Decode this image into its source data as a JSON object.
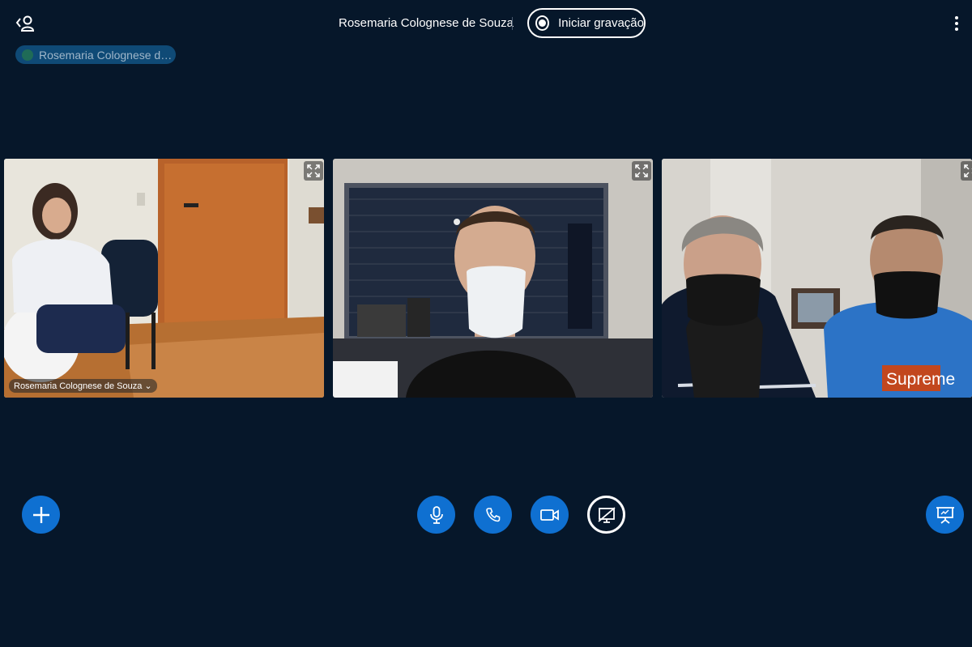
{
  "header": {
    "meeting_title": "Rosemaria Colognese de Souza",
    "record_label": "Iniciar gravação"
  },
  "talker": {
    "name": "Rosemaria Colognese de Souza"
  },
  "videos": [
    {
      "user_label": "Rosemaria Colognese de Souza ⌄"
    },
    {
      "user_label": ""
    },
    {
      "user_label": ""
    }
  ],
  "video_overlay_text": "Supreme",
  "icons": {
    "users_toggle": "users-toggle-icon",
    "record": "record-icon",
    "more": "more-options-icon",
    "expand": "fullscreen-icon",
    "actions": "plus-icon",
    "mic": "microphone-icon",
    "phone": "phone-icon",
    "camera": "video-camera-icon",
    "share": "screen-share-off-icon",
    "presentation": "presentation-icon"
  },
  "colors": {
    "background": "#06172a",
    "primary_button": "#0f70d1",
    "talker_pill": "#0f4a76"
  }
}
